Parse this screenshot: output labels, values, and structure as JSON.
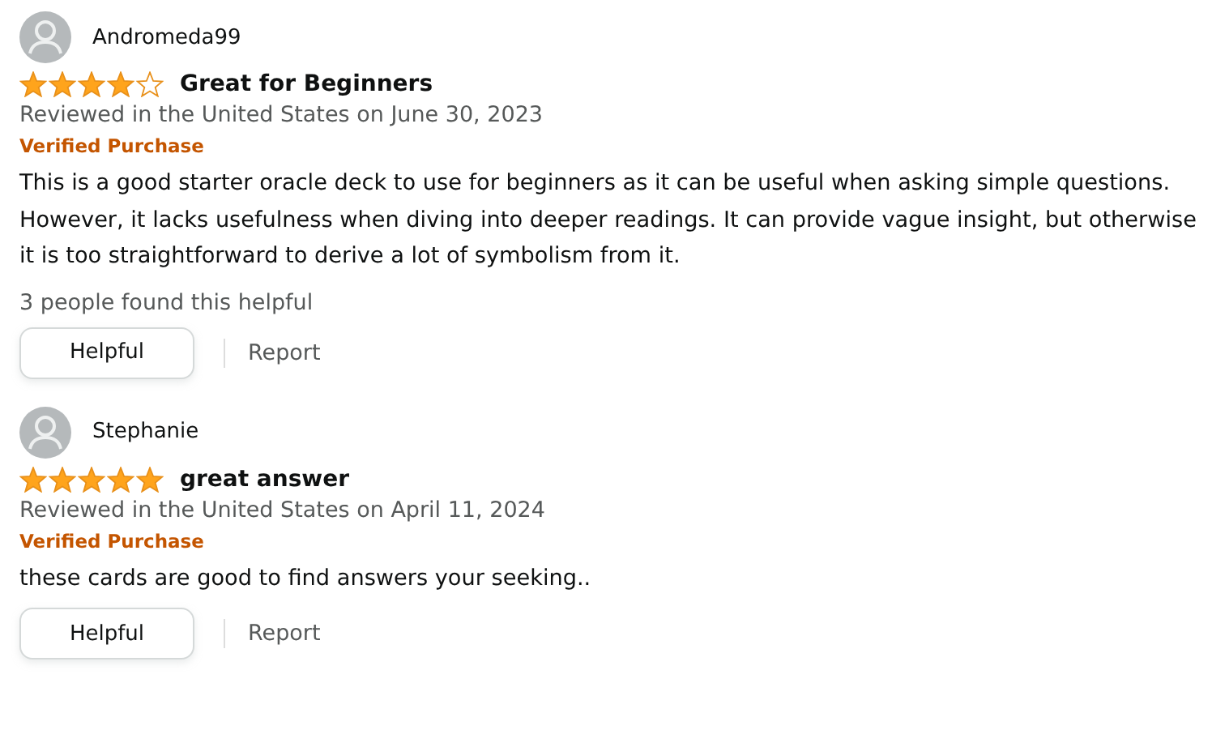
{
  "reviews": [
    {
      "author": "Andromeda99",
      "stars": 4,
      "title": "Great for Beginners",
      "date": "Reviewed in the United States on June 30, 2023",
      "badge": "Verified Purchase",
      "body": "This is a good starter oracle deck to use for beginners as it can be useful when asking simple questions. However, it lacks usefulness when diving into deeper readings. It can provide vague insight, but otherwise it is too straightforward to derive a lot of symbolism from it.",
      "helpful_count": "3 people found this helpful",
      "buttons": [
        "Helpful",
        "Report"
      ]
    },
    {
      "author": "Stephanie",
      "stars": 5,
      "title": "great answer",
      "date": "Reviewed in the United States on April 11, 2024",
      "badge": "Verified Purchase",
      "body": "these cards are good to find answers your seeking..",
      "buttons": [
        "Helpful",
        "Report"
      ]
    }
  ]
}
